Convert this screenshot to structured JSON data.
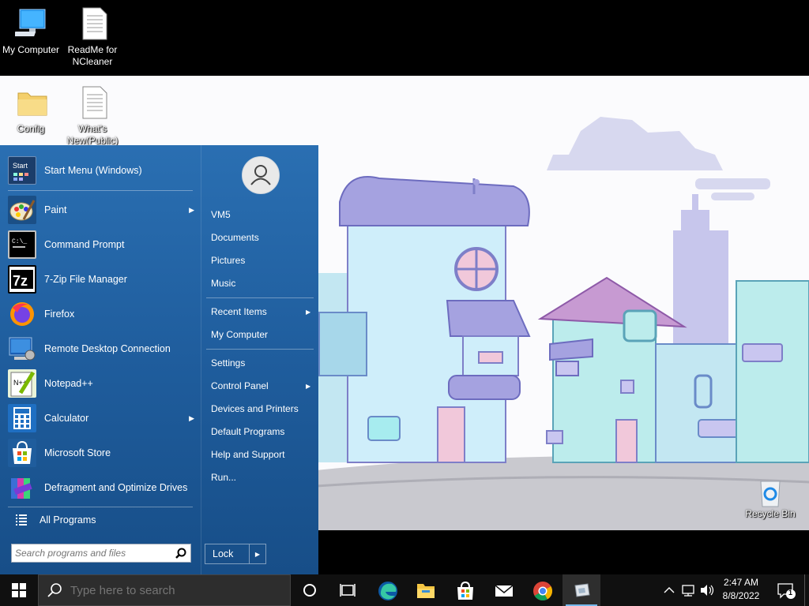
{
  "desktop": {
    "icons": [
      {
        "label": "My Computer",
        "icon": "computer-icon"
      },
      {
        "label": "ReadMe for NCleaner",
        "icon": "text-file-icon"
      },
      {
        "label": "Config",
        "icon": "folder-icon"
      },
      {
        "label": "What's New(Public)",
        "icon": "text-file-icon"
      },
      {
        "label": "Recycle Bin",
        "icon": "recycle-bin-icon"
      }
    ]
  },
  "start_menu": {
    "header": {
      "label": "Start Menu (Windows)",
      "icon": "start-menu-app-icon"
    },
    "programs": [
      {
        "label": "Paint",
        "icon": "paint-icon",
        "has_submenu": true
      },
      {
        "label": "Command Prompt",
        "icon": "command-prompt-icon",
        "has_submenu": false
      },
      {
        "label": "7-Zip File Manager",
        "icon": "7zip-icon",
        "has_submenu": false
      },
      {
        "label": "Firefox",
        "icon": "firefox-icon",
        "has_submenu": false
      },
      {
        "label": "Remote Desktop Connection",
        "icon": "remote-desktop-icon",
        "has_submenu": false
      },
      {
        "label": "Notepad++",
        "icon": "notepadpp-icon",
        "has_submenu": false
      },
      {
        "label": "Calculator",
        "icon": "calculator-icon",
        "has_submenu": true
      },
      {
        "label": "Microsoft Store",
        "icon": "store-icon",
        "has_submenu": false
      },
      {
        "label": "Defragment and Optimize Drives",
        "icon": "defrag-icon",
        "has_submenu": false
      }
    ],
    "all_programs": "All Programs",
    "search_placeholder": "Search programs and files",
    "right": {
      "user_name": "VM5",
      "items": [
        {
          "label": "Documents"
        },
        {
          "label": "Pictures"
        },
        {
          "label": "Music"
        },
        {
          "label": "Recent Items",
          "has_submenu": true
        },
        {
          "label": "My Computer"
        },
        {
          "label": "Settings"
        },
        {
          "label": "Control Panel",
          "has_submenu": true
        },
        {
          "label": "Devices and Printers"
        },
        {
          "label": "Default Programs"
        },
        {
          "label": "Help and Support"
        },
        {
          "label": "Run..."
        }
      ],
      "lock_label": "Lock"
    },
    "arrow": "▶"
  },
  "taskbar": {
    "search_placeholder": "Type here to search",
    "pinned": [
      "cortana-icon",
      "task-view-icon",
      "edge-icon",
      "file-explorer-icon",
      "store-icon",
      "mail-icon",
      "chrome-icon",
      "classic-shell-icon"
    ],
    "clock": {
      "time": "2:47 AM",
      "date": "8/8/2022"
    },
    "notification_count": "1"
  },
  "colors": {
    "start_menu_bg": "#1f5d9d",
    "taskbar_bg": "#101010",
    "accent": "#0078d7"
  }
}
